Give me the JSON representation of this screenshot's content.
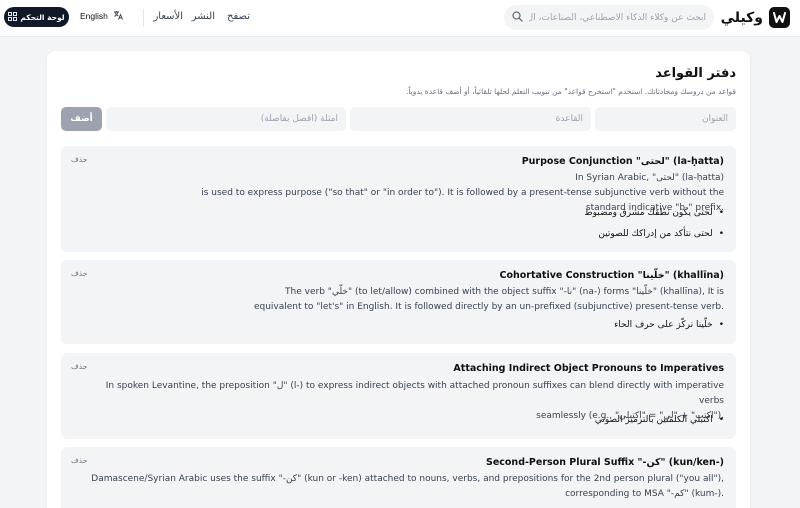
{
  "header": {
    "brand": "وكيلي",
    "search_placeholder": "ابحث عن وكلاء الذكاء الاصطناعي، الصناعات، ال",
    "nav": [
      "تصفح",
      "النشر",
      "الأسعار"
    ],
    "language": "English",
    "dashboard": "لوحة التحكم"
  },
  "page": {
    "title": "دفتر القواعد",
    "subtitle": "قواعد من دروسك ومحادثاتك. استخدم \"استخرج قواعد\" من تبويب التعلم لحلها تلقائياً، أو أضف قاعدة يدوياً.",
    "fields": {
      "title_placeholder": "العنوان",
      "rule_placeholder": "القاعدة",
      "examples_placeholder": "أمثلة (افصل بفاصلة)",
      "add": "أضف"
    }
  },
  "rules": [
    {
      "title": "Purpose Conjunction \"لحتى\" (la-ḥatta)",
      "delete": "حذف",
      "desc": [
        "In Syrian Arabic, \"لحتى\" (la-ḥatta)",
        "is used to express purpose (\"so that\" or \"in order to\"). It is followed by a present-tense subjunctive verb without the",
        "standard indicative \"b-\" prefix."
      ],
      "examples": [
        "لحتى يكون نطقك مشرق ومضبوط",
        "لحتى نتأكد من إدراكك للصوتين"
      ]
    },
    {
      "title": "Cohortative Construction \"خلّينا\" (khallīna)",
      "delete": "حذف",
      "desc": [
        "The verb \"خلّي\" (to let/allow) combined with the object suffix \"-نا\" (na-) forms \"خلّينا\" (khallīna), It is",
        "equivalent to \"let's\" in English. It is followed directly by an un-prefixed (subjunctive) present-tense verb."
      ],
      "examples": [
        "خلّينا نركّز على حرف الحاء"
      ]
    },
    {
      "title": "Attaching Indirect Object Pronouns to Imperatives",
      "delete": "حذف",
      "desc": [
        "In spoken Levantine, the preposition \"ل\" (l-) to express indirect objects with attached pronoun suffixes can blend directly with imperative verbs",
        "seamlessly (e.g., \"اكتب\" + \"لي\" = \"اكتبلي\")."
      ],
      "examples": [
        "اكتبلي الكلمتين بالترميز الصوتي"
      ]
    },
    {
      "title": "Second-Person Plural Suffix \"-كن\" (kun/ken-)",
      "delete": "حذف",
      "desc": [
        "Damascene/Syrian Arabic uses the suffix \"-كن\" (kun or -ken) attached to nouns, verbs, and prepositions for the 2nd person plural (\"you all\"),",
        "corresponding to MSA \"-كم\" (kum-)."
      ],
      "examples": []
    }
  ]
}
